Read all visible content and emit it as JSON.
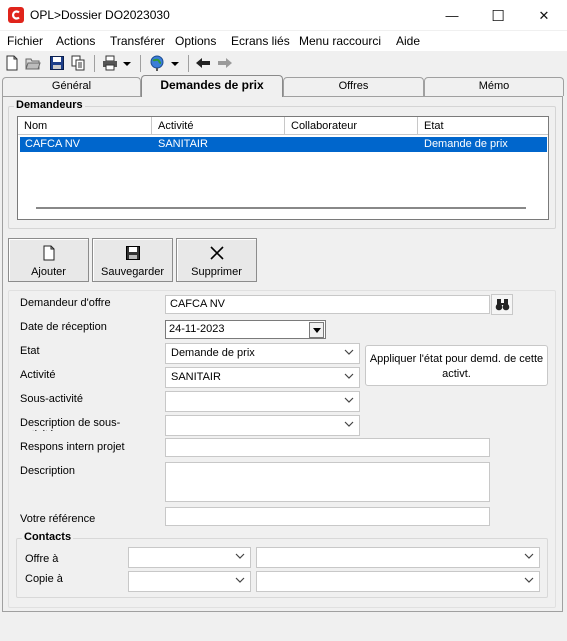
{
  "window": {
    "title": "OPL>Dossier   DO2023030",
    "minimize": "—",
    "maximize": "☐",
    "close": "✕"
  },
  "menu": [
    "Fichier",
    "Actions",
    "Transférer",
    "Options",
    "Ecrans liés",
    "Menu raccourci",
    "Aide"
  ],
  "tabs": [
    {
      "label": "Général",
      "active": false
    },
    {
      "label": "Demandes de prix",
      "active": true
    },
    {
      "label": "Offres",
      "active": false
    },
    {
      "label": "Mémo",
      "active": false
    }
  ],
  "demandeurs": {
    "title": "Demandeurs",
    "columns": [
      "Nom",
      "Activité",
      "Collaborateur",
      "Etat"
    ],
    "rows": [
      [
        "CAFCA NV",
        "SANITAIR",
        "",
        "Demande de prix"
      ]
    ]
  },
  "actions": {
    "add": "Ajouter",
    "save": "Sauvegarder",
    "delete": "Supprimer"
  },
  "form": {
    "demandeur_label": "Demandeur d'offre",
    "demandeur_value": "CAFCA NV",
    "date_label": "Date de réception",
    "date_value": "24-11-2023",
    "etat_label": "Etat",
    "etat_value": "Demande de prix",
    "apply_button": "Appliquer l'état pour demd. de cette activt.",
    "activite_label": "Activité",
    "activite_value": "SANITAIR",
    "sous_activite_label": "Sous-activité",
    "sous_activite_value": "",
    "description_activite_label": "Description de sous-activité",
    "description_activite_value": "",
    "responsable_label": "Respons intern projet",
    "responsable_value": "",
    "description_label": "Description",
    "description_value": "",
    "reference_label": "Votre référence",
    "reference_value": ""
  },
  "contacts": {
    "title": "Contacts",
    "offre_label": "Offre à",
    "copie_label": "Copie à"
  },
  "colors": {
    "selection": "#0066cc",
    "brand_icon": "#e0241b"
  }
}
